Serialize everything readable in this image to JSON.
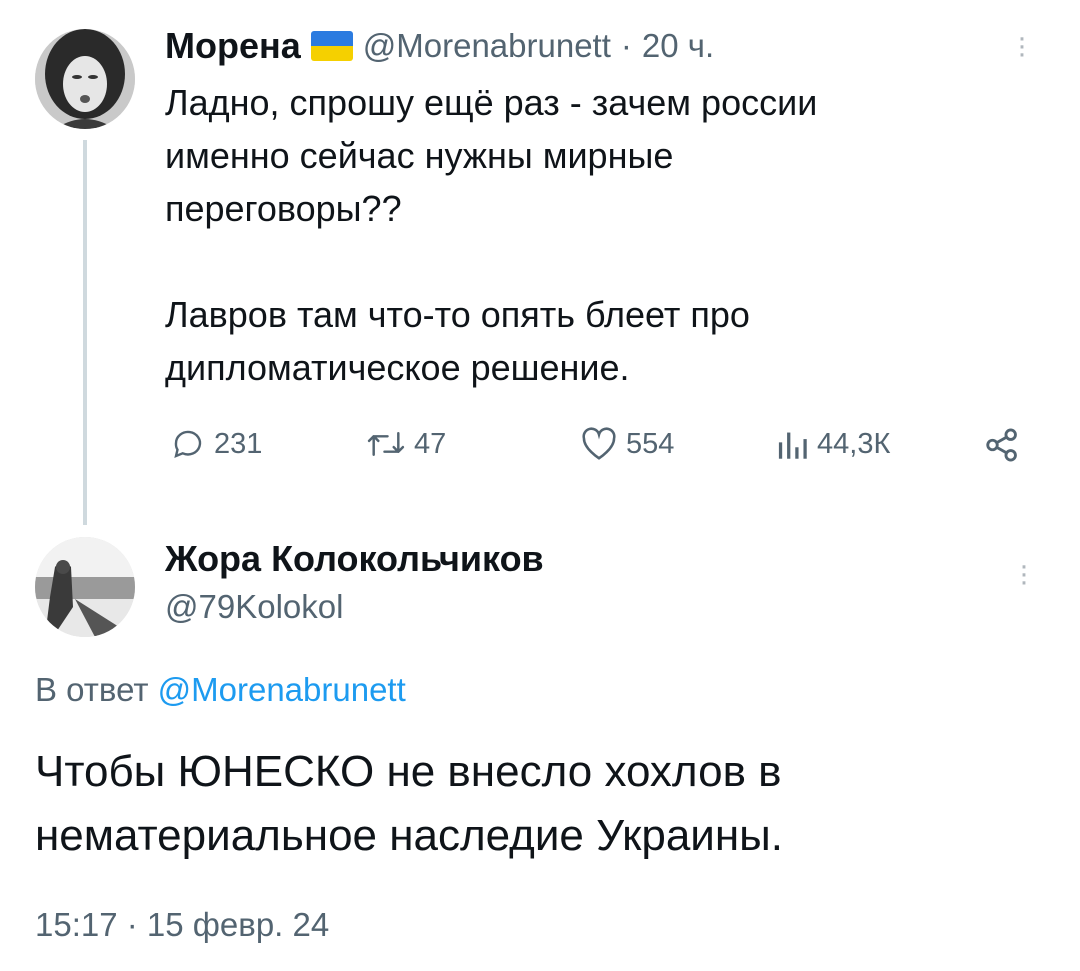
{
  "parent_tweet": {
    "author_name": "Морена",
    "flag_icon": "ukraine-flag",
    "handle": "@Morenabrunett",
    "separator": "·",
    "time_ago": "20 ч.",
    "text": "Ладно, спрошу ещё раз - зачем россии\nименно сейчас нужны мирные\nпереговоры??\n\nЛавров там что-то опять блеет про\nдипломатическое решение.",
    "actions": {
      "replies": "231",
      "retweets": "47",
      "likes": "554",
      "views": "44,3К"
    }
  },
  "reply_tweet": {
    "author_name": "Жора Колокольчиков",
    "handle": "@79Kolokol",
    "reply_prefix": "В ответ",
    "reply_to": "@Morenabrunett",
    "text": "Чтобы ЮНЕСКО не внесло хохлов в\nнематериальное наследие Украины.",
    "timestamp": "15:17 · 15 февр. 24"
  },
  "colors": {
    "text": "#0f1419",
    "muted": "#536471",
    "link": "#1d9bf0",
    "thread_line": "#cfd9de"
  }
}
